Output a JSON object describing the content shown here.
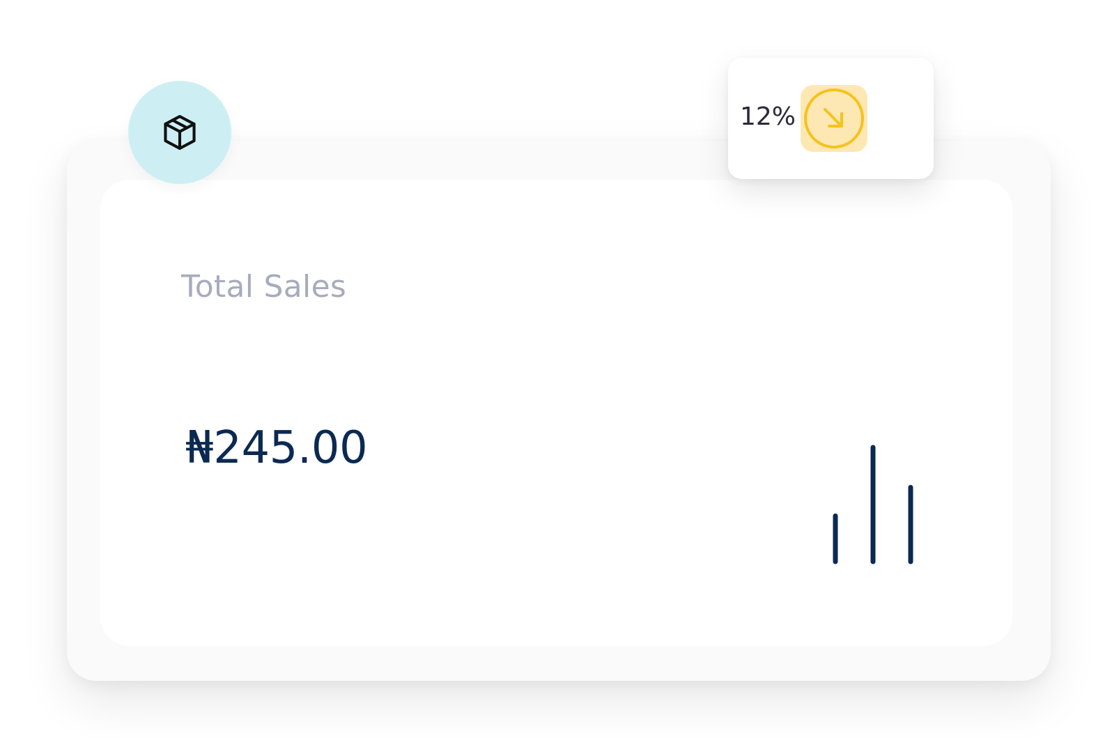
{
  "card": {
    "title": "Total Sales",
    "amount": "₦245.00",
    "icon": "package-box-icon"
  },
  "change": {
    "value": "12%",
    "direction": "down",
    "icon": "arrow-down-right-circle-icon"
  },
  "chart_data": {
    "type": "bar",
    "categories": [
      "",
      "",
      ""
    ],
    "values": [
      4,
      10,
      6.5
    ],
    "title": "",
    "xlabel": "",
    "ylabel": ""
  },
  "colors": {
    "navy": "#0b2a52",
    "label_gray": "#a8abbc",
    "icon_circle_bg": "#cdeff4",
    "trend_tile_bg": "#fde8b4",
    "trend_yellow": "#f6c21c"
  }
}
